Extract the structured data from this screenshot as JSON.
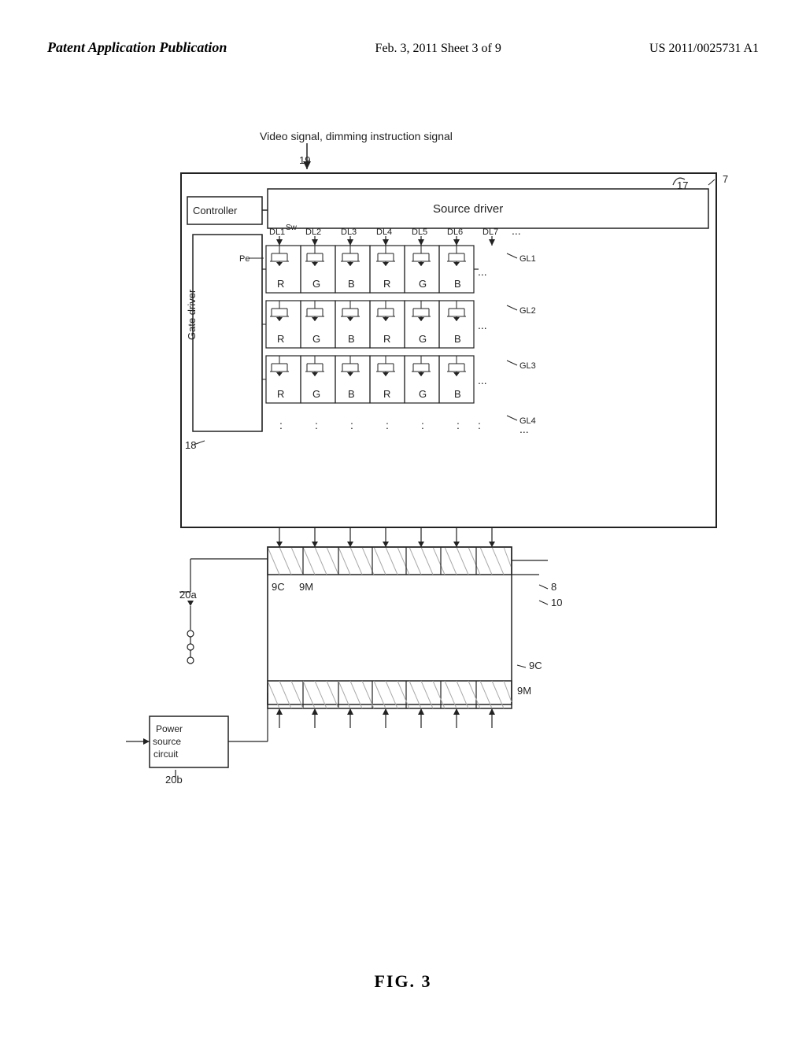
{
  "header": {
    "left_label": "Patent Application Publication",
    "center_label": "Feb. 3, 2011     Sheet 3 of 9",
    "right_label": "US 2011/0025731 A1"
  },
  "figure": {
    "caption": "FIG. 3",
    "title": "Video signal, dimming instruction signal",
    "labels": {
      "controller": "Controller",
      "source_driver": "Source driver",
      "gate_driver": "Gate driver",
      "power_source": "Power\nsource\ncircuit",
      "num_7": "7",
      "num_17": "17",
      "num_18": "18",
      "num_19": "19",
      "num_8": "8",
      "num_10": "10",
      "num_20a": "20a",
      "num_20b": "20b",
      "num_9c_top": "9C",
      "num_9m_top": "9M",
      "num_9c_bot": "9C",
      "num_9m_bot": "9M",
      "dl1": "DL1",
      "dl2": "DL2",
      "dl3": "DL3",
      "dl4": "DL4",
      "dl5": "DL5",
      "dl6": "DL6",
      "dl7": "DL7",
      "gl1": "GL1",
      "gl2": "GL2",
      "gl3": "GL3",
      "gl4": "GL4",
      "sw": "Sw",
      "pe": "Pe",
      "r": "R",
      "g": "G",
      "b": "B"
    }
  }
}
